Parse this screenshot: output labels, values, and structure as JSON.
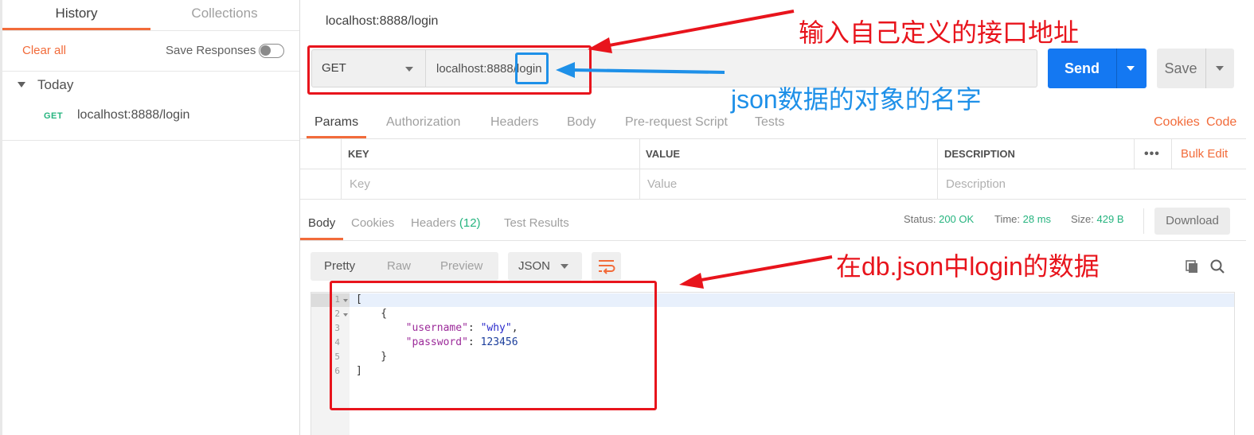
{
  "sidebar": {
    "tabs": [
      {
        "label": "History",
        "active": true
      },
      {
        "label": "Collections",
        "active": false
      }
    ],
    "clear_all": "Clear all",
    "save_responses": "Save Responses",
    "group_label": "Today",
    "history_items": [
      {
        "method": "GET",
        "url": "localhost:8888/login"
      }
    ]
  },
  "request": {
    "title": "localhost:8888/login",
    "method": "GET",
    "url": "localhost:8888/login",
    "send_label": "Send",
    "save_label": "Save",
    "tabs": [
      "Params",
      "Authorization",
      "Headers",
      "Body",
      "Pre-request Script",
      "Tests"
    ],
    "active_tab": "Params",
    "links": [
      "Cookies",
      "Code"
    ]
  },
  "params_table": {
    "headers": [
      "KEY",
      "VALUE",
      "DESCRIPTION"
    ],
    "placeholders": [
      "Key",
      "Value",
      "Description"
    ],
    "bulk_edit": "Bulk Edit",
    "more": "•••"
  },
  "response": {
    "tabs": [
      "Body",
      "Cookies",
      "Headers",
      "Test Results"
    ],
    "headers_count": "(12)",
    "status_label": "Status:",
    "status_value": "200 OK",
    "time_label": "Time:",
    "time_value": "28 ms",
    "size_label": "Size:",
    "size_value": "429 B",
    "download_label": "Download",
    "formats": [
      "Pretty",
      "Raw",
      "Preview"
    ],
    "format_type": "JSON",
    "line_numbers": [
      "1",
      "2",
      "3",
      "4",
      "5",
      "6"
    ],
    "code": {
      "line1": "[",
      "line2": "    {",
      "key_username": "\"username\"",
      "val_username": "\"why\"",
      "key_password": "\"password\"",
      "val_password": "123456",
      "line5": "    }",
      "line6": "]"
    }
  },
  "annotations": {
    "red_top": "输入自己定义的接口地址",
    "blue": "json数据的对象的名字",
    "red_bottom": "在db.json中login的数据"
  },
  "colors": {
    "accent": "#f26b3a",
    "send": "#1478f2",
    "success": "#26b47f",
    "annotation_red": "#e8141c",
    "annotation_blue": "#1e90e8"
  }
}
